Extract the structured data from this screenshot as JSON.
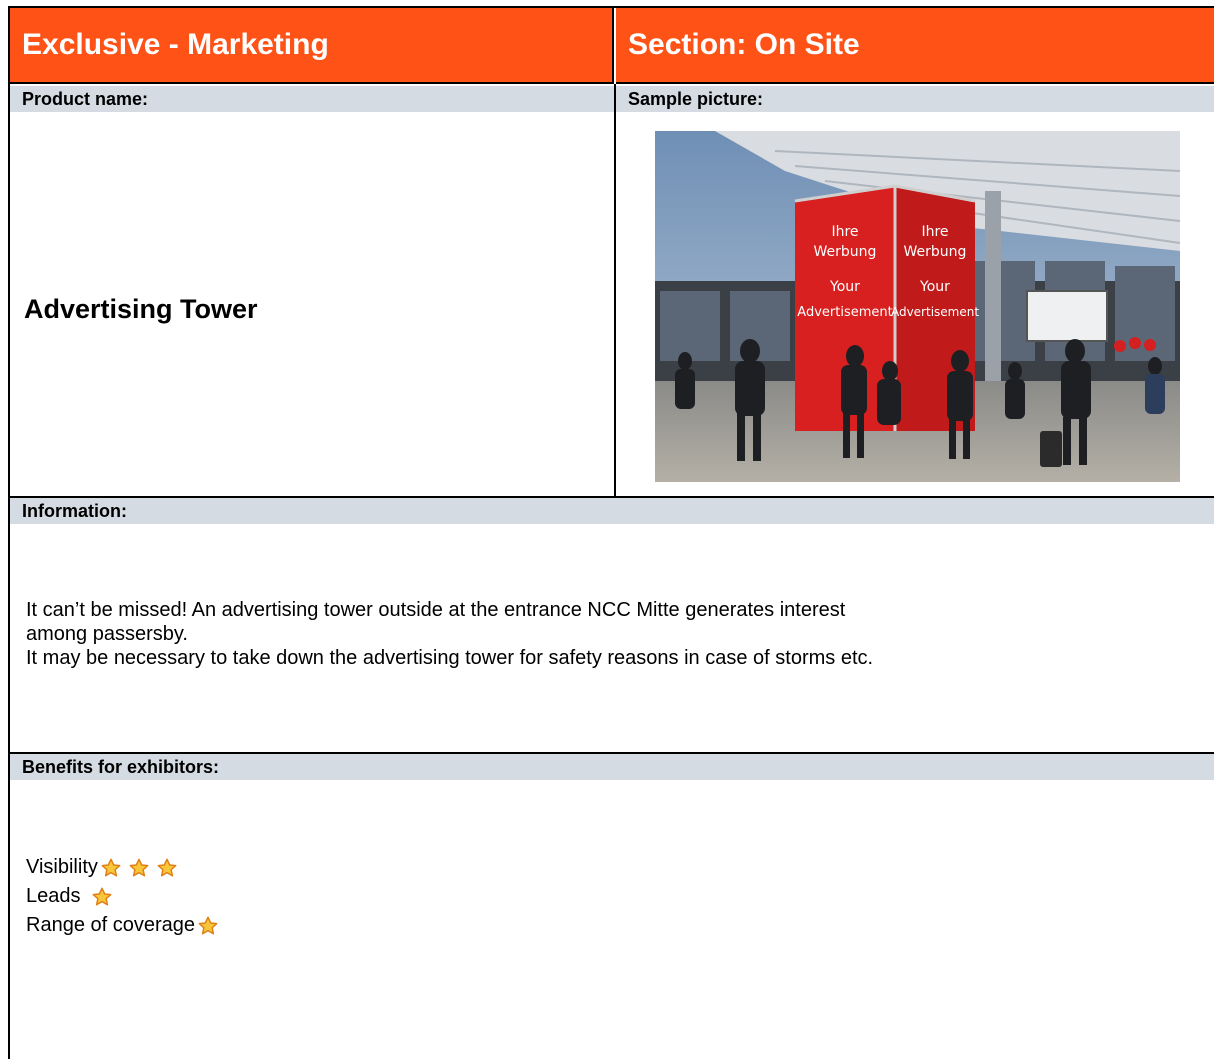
{
  "header": {
    "left_title": "Exclusive - Marketing",
    "right_title": "Section: On Site"
  },
  "labels": {
    "product_name": "Product name:",
    "sample_picture": "Sample picture:",
    "information": "Information:",
    "benefits": "Benefits for exhibitors:"
  },
  "product": {
    "name": "Advertising Tower"
  },
  "photo": {
    "sign_text": [
      "Ihre",
      "Werbung",
      "Your",
      "Advertisement"
    ]
  },
  "information": {
    "line1": "It can’t be missed! An advertising tower outside at the entrance NCC Mitte generates interest",
    "line2": "among passersby.",
    "line3": "It may be necessary to take down the advertising tower for safety reasons in case of storms etc."
  },
  "benefits": [
    {
      "label": "Visibility",
      "stars": 3
    },
    {
      "label": "Leads",
      "stars": 1
    },
    {
      "label": "Range of coverage",
      "stars": 1
    }
  ],
  "colors": {
    "header_bg": "#fe5216",
    "subheader_bg": "#d4dbe2",
    "star_fill": "#f8c63a",
    "star_stroke": "#e07f12"
  }
}
